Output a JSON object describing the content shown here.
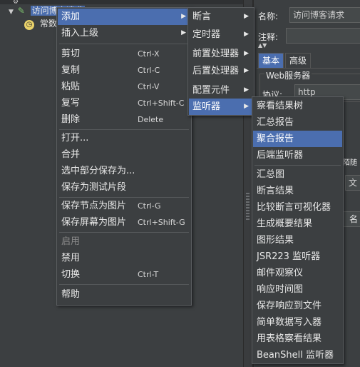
{
  "tree": {
    "test_name": "访问博客请求",
    "child_label": "常数"
  },
  "panel": {
    "name_label": "名称:",
    "name_value": "访问博客请求",
    "comment_label": "注释:",
    "tab_basic": "基本",
    "tab_advanced": "高级",
    "section_web": "Web服务器",
    "protocol_label": "协议:",
    "protocol_value": "http",
    "partial_label_1": "陌随",
    "partial_label_2": "文",
    "partial_label_3": "名"
  },
  "context_menu": {
    "items": [
      {
        "label": "添加",
        "shortcut": "",
        "submenu": true
      },
      {
        "label": "插入上级",
        "shortcut": "",
        "submenu": true
      },
      {
        "label": "剪切",
        "shortcut": "Ctrl-X"
      },
      {
        "label": "复制",
        "shortcut": "Ctrl-C"
      },
      {
        "label": "粘贴",
        "shortcut": "Ctrl-V"
      },
      {
        "label": "复写",
        "shortcut": "Ctrl+Shift-C"
      },
      {
        "label": "删除",
        "shortcut": "Delete"
      },
      {
        "label": "打开...",
        "shortcut": ""
      },
      {
        "label": "合并",
        "shortcut": ""
      },
      {
        "label": "选中部分保存为...",
        "shortcut": ""
      },
      {
        "label": "保存为测试片段",
        "shortcut": ""
      },
      {
        "label": "保存节点为图片",
        "shortcut": "Ctrl-G"
      },
      {
        "label": "保存屏幕为图片",
        "shortcut": "Ctrl+Shift-G"
      },
      {
        "label": "启用",
        "shortcut": ""
      },
      {
        "label": "禁用",
        "shortcut": ""
      },
      {
        "label": "切换",
        "shortcut": "Ctrl-T"
      },
      {
        "label": "帮助",
        "shortcut": ""
      }
    ]
  },
  "add_submenu": {
    "items": [
      "断言",
      "定时器",
      "前置处理器",
      "后置处理器",
      "配置元件",
      "监听器"
    ]
  },
  "listener_submenu": {
    "items": [
      "察看结果树",
      "汇总报告",
      "聚合报告",
      "后端监听器",
      "汇总图",
      "断言结果",
      "比较断言可视化器",
      "生成概要结果",
      "图形结果",
      "JSR223 监听器",
      "邮件观察仪",
      "响应时间图",
      "保存响应到文件",
      "简单数据写入器",
      "用表格察看结果",
      "BeanShell 监听器"
    ]
  }
}
